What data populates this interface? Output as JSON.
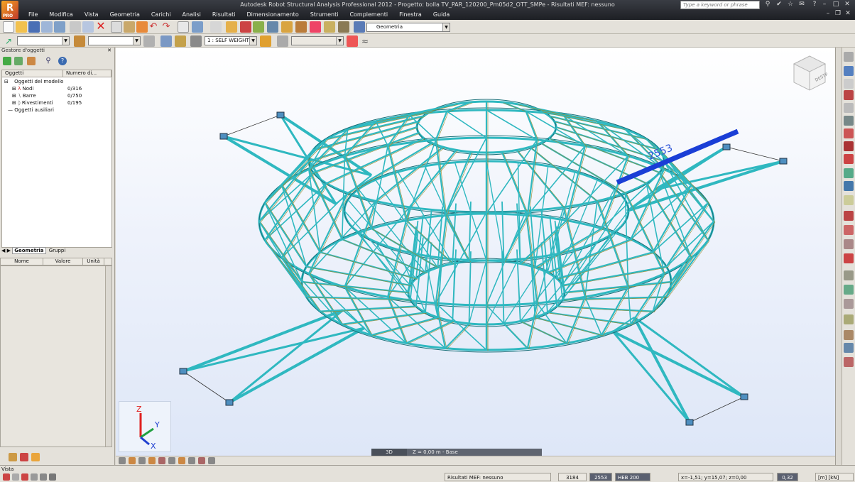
{
  "window": {
    "title": "Autodesk Robot Structural Analysis Professional 2012 - Progetto: bolla TV_PAR_120200_Pm05d2_OTT_SMPe - Risultati MEF: nessuno",
    "search_placeholder": "Type a keyword or phrase",
    "logo_badge": "PRO"
  },
  "menu": [
    "File",
    "Modifica",
    "Vista",
    "Geometria",
    "Carichi",
    "Analisi",
    "Risultati",
    "Dimensionamento",
    "Strumenti",
    "Complementi",
    "Finestra",
    "Guida"
  ],
  "toolbar": {
    "layout_dropdown": "Geometria",
    "loadcase_dropdown": "1 : SELF WEIGHT"
  },
  "object_inspector": {
    "title": "Gestore d'oggetti",
    "columns": [
      "Oggetti",
      "Numero di..."
    ],
    "tree": [
      {
        "label": "Oggetti del modello",
        "count": ""
      },
      {
        "label": "Nodi",
        "count": "0/316"
      },
      {
        "label": "Barre",
        "count": "0/750"
      },
      {
        "label": "Rivestimenti",
        "count": "0/195"
      },
      {
        "label": "Oggetti ausiliari",
        "count": ""
      }
    ],
    "tabs": [
      "Geometria",
      "Gruppi"
    ],
    "prop_columns": [
      "Nome",
      "Valore",
      "Unità"
    ]
  },
  "viewport": {
    "selected_bar_label": "2553",
    "mode": "3D",
    "plane": "Z = 0,00 m - Base",
    "viewcube_labels": [
      "DESTRA"
    ],
    "axes": {
      "z": "Z",
      "y": "Y",
      "x": "X"
    }
  },
  "status": {
    "left_text": "Vista",
    "results": "Risultati MEF: nessuno",
    "nodes": "3184",
    "bar": "2553",
    "section": "HEB 200",
    "coords": "x=-1,51; y=15,07; z=0,00",
    "scale": "0,32",
    "units": "[m] [kN] [Deg]"
  }
}
